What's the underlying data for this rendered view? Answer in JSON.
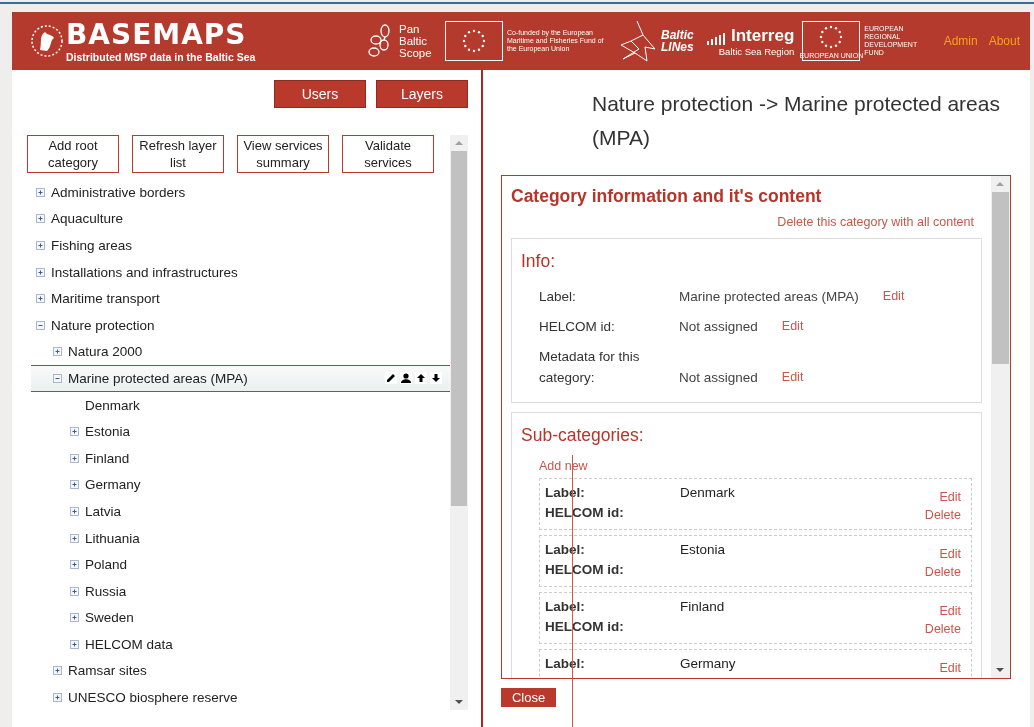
{
  "header": {
    "logo_title": "BASEMAPS",
    "logo_subtitle": "Distributed MSP data in the Baltic Sea",
    "partners": [
      {
        "kind": "panbaltic",
        "lines": [
          "Pan",
          "Baltic",
          "Scope"
        ]
      },
      {
        "kind": "eu",
        "text": "Co-funded by the European Maritime and Fisheries Fund of the European Union"
      },
      {
        "kind": "balticlines",
        "lines": [
          "Baltic",
          "LINes"
        ]
      },
      {
        "kind": "interreg",
        "title": "Interreg",
        "subtitle": "Baltic Sea Region"
      },
      {
        "kind": "eu",
        "text": "EUROPEAN REGIONAL DEVELOPMENT FUND",
        "caption": "EUROPEAN UNION"
      }
    ],
    "nav": [
      "Admin",
      "About"
    ]
  },
  "left": {
    "buttons": [
      "Users",
      "Layers"
    ],
    "tools": [
      "Add root category",
      "Refresh layer list",
      "View services summary",
      "Validate services"
    ],
    "tree": [
      {
        "label": "Administrative borders",
        "kind": "folder",
        "expanded": false,
        "selected": false
      },
      {
        "label": "Aquaculture",
        "kind": "folder",
        "expanded": false,
        "selected": false
      },
      {
        "label": "Fishing areas",
        "kind": "folder",
        "expanded": false,
        "selected": false
      },
      {
        "label": "Installations and infrastructures",
        "kind": "folder",
        "expanded": false,
        "selected": false
      },
      {
        "label": "Maritime transport",
        "kind": "folder",
        "expanded": false,
        "selected": false
      },
      {
        "label": "Nature protection",
        "kind": "folder",
        "expanded": true,
        "selected": false,
        "children": [
          {
            "label": "Natura 2000",
            "kind": "folder",
            "expanded": false,
            "selected": false
          },
          {
            "label": "Marine protected areas (MPA)",
            "kind": "folder",
            "expanded": true,
            "selected": true,
            "children": [
              {
                "label": "Denmark",
                "kind": "leaf",
                "expanded": false,
                "selected": false
              },
              {
                "label": "Estonia",
                "kind": "folder",
                "expanded": false,
                "selected": false
              },
              {
                "label": "Finland",
                "kind": "folder",
                "expanded": false,
                "selected": false
              },
              {
                "label": "Germany",
                "kind": "folder",
                "expanded": false,
                "selected": false
              },
              {
                "label": "Latvia",
                "kind": "folder",
                "expanded": false,
                "selected": false
              },
              {
                "label": "Lithuania",
                "kind": "folder",
                "expanded": false,
                "selected": false
              },
              {
                "label": "Poland",
                "kind": "folder",
                "expanded": false,
                "selected": false
              },
              {
                "label": "Russia",
                "kind": "folder",
                "expanded": false,
                "selected": false
              },
              {
                "label": "Sweden",
                "kind": "folder",
                "expanded": false,
                "selected": false
              },
              {
                "label": "HELCOM data",
                "kind": "folder",
                "expanded": false,
                "selected": false
              }
            ]
          },
          {
            "label": "Ramsar sites",
            "kind": "folder",
            "expanded": false,
            "selected": false
          },
          {
            "label": "UNESCO biosphere reserve",
            "kind": "folder",
            "expanded": false,
            "selected": false
          }
        ]
      }
    ]
  },
  "right": {
    "title": "Nature protection -> Marine protected areas (MPA)",
    "panel": {
      "heading": "Category information and it's content",
      "delete_link": "Delete this category with all content",
      "info": {
        "heading": "Info:",
        "rows": [
          {
            "label": "Label:",
            "value": "Marine protected areas (MPA)",
            "action": "Edit"
          },
          {
            "label": "HELCOM id:",
            "value": "Not assigned",
            "action": "Edit"
          },
          {
            "label": "Metadata for this category:",
            "value": "Not assigned",
            "action": "Edit"
          }
        ]
      },
      "subcategories": {
        "heading": "Sub-categories:",
        "add_link": "Add new",
        "items": [
          {
            "label_caption": "Label:",
            "label": "Denmark",
            "helcom_caption": "HELCOM id:",
            "actions": [
              "Edit",
              "Delete"
            ]
          },
          {
            "label_caption": "Label:",
            "label": "Estonia",
            "helcom_caption": "HELCOM id:",
            "actions": [
              "Edit",
              "Delete"
            ]
          },
          {
            "label_caption": "Label:",
            "label": "Finland",
            "helcom_caption": "HELCOM id:",
            "actions": [
              "Edit",
              "Delete"
            ]
          },
          {
            "label_caption": "Label:",
            "label": "Germany",
            "actions": [
              "Edit"
            ]
          }
        ]
      }
    },
    "close": "Close"
  }
}
